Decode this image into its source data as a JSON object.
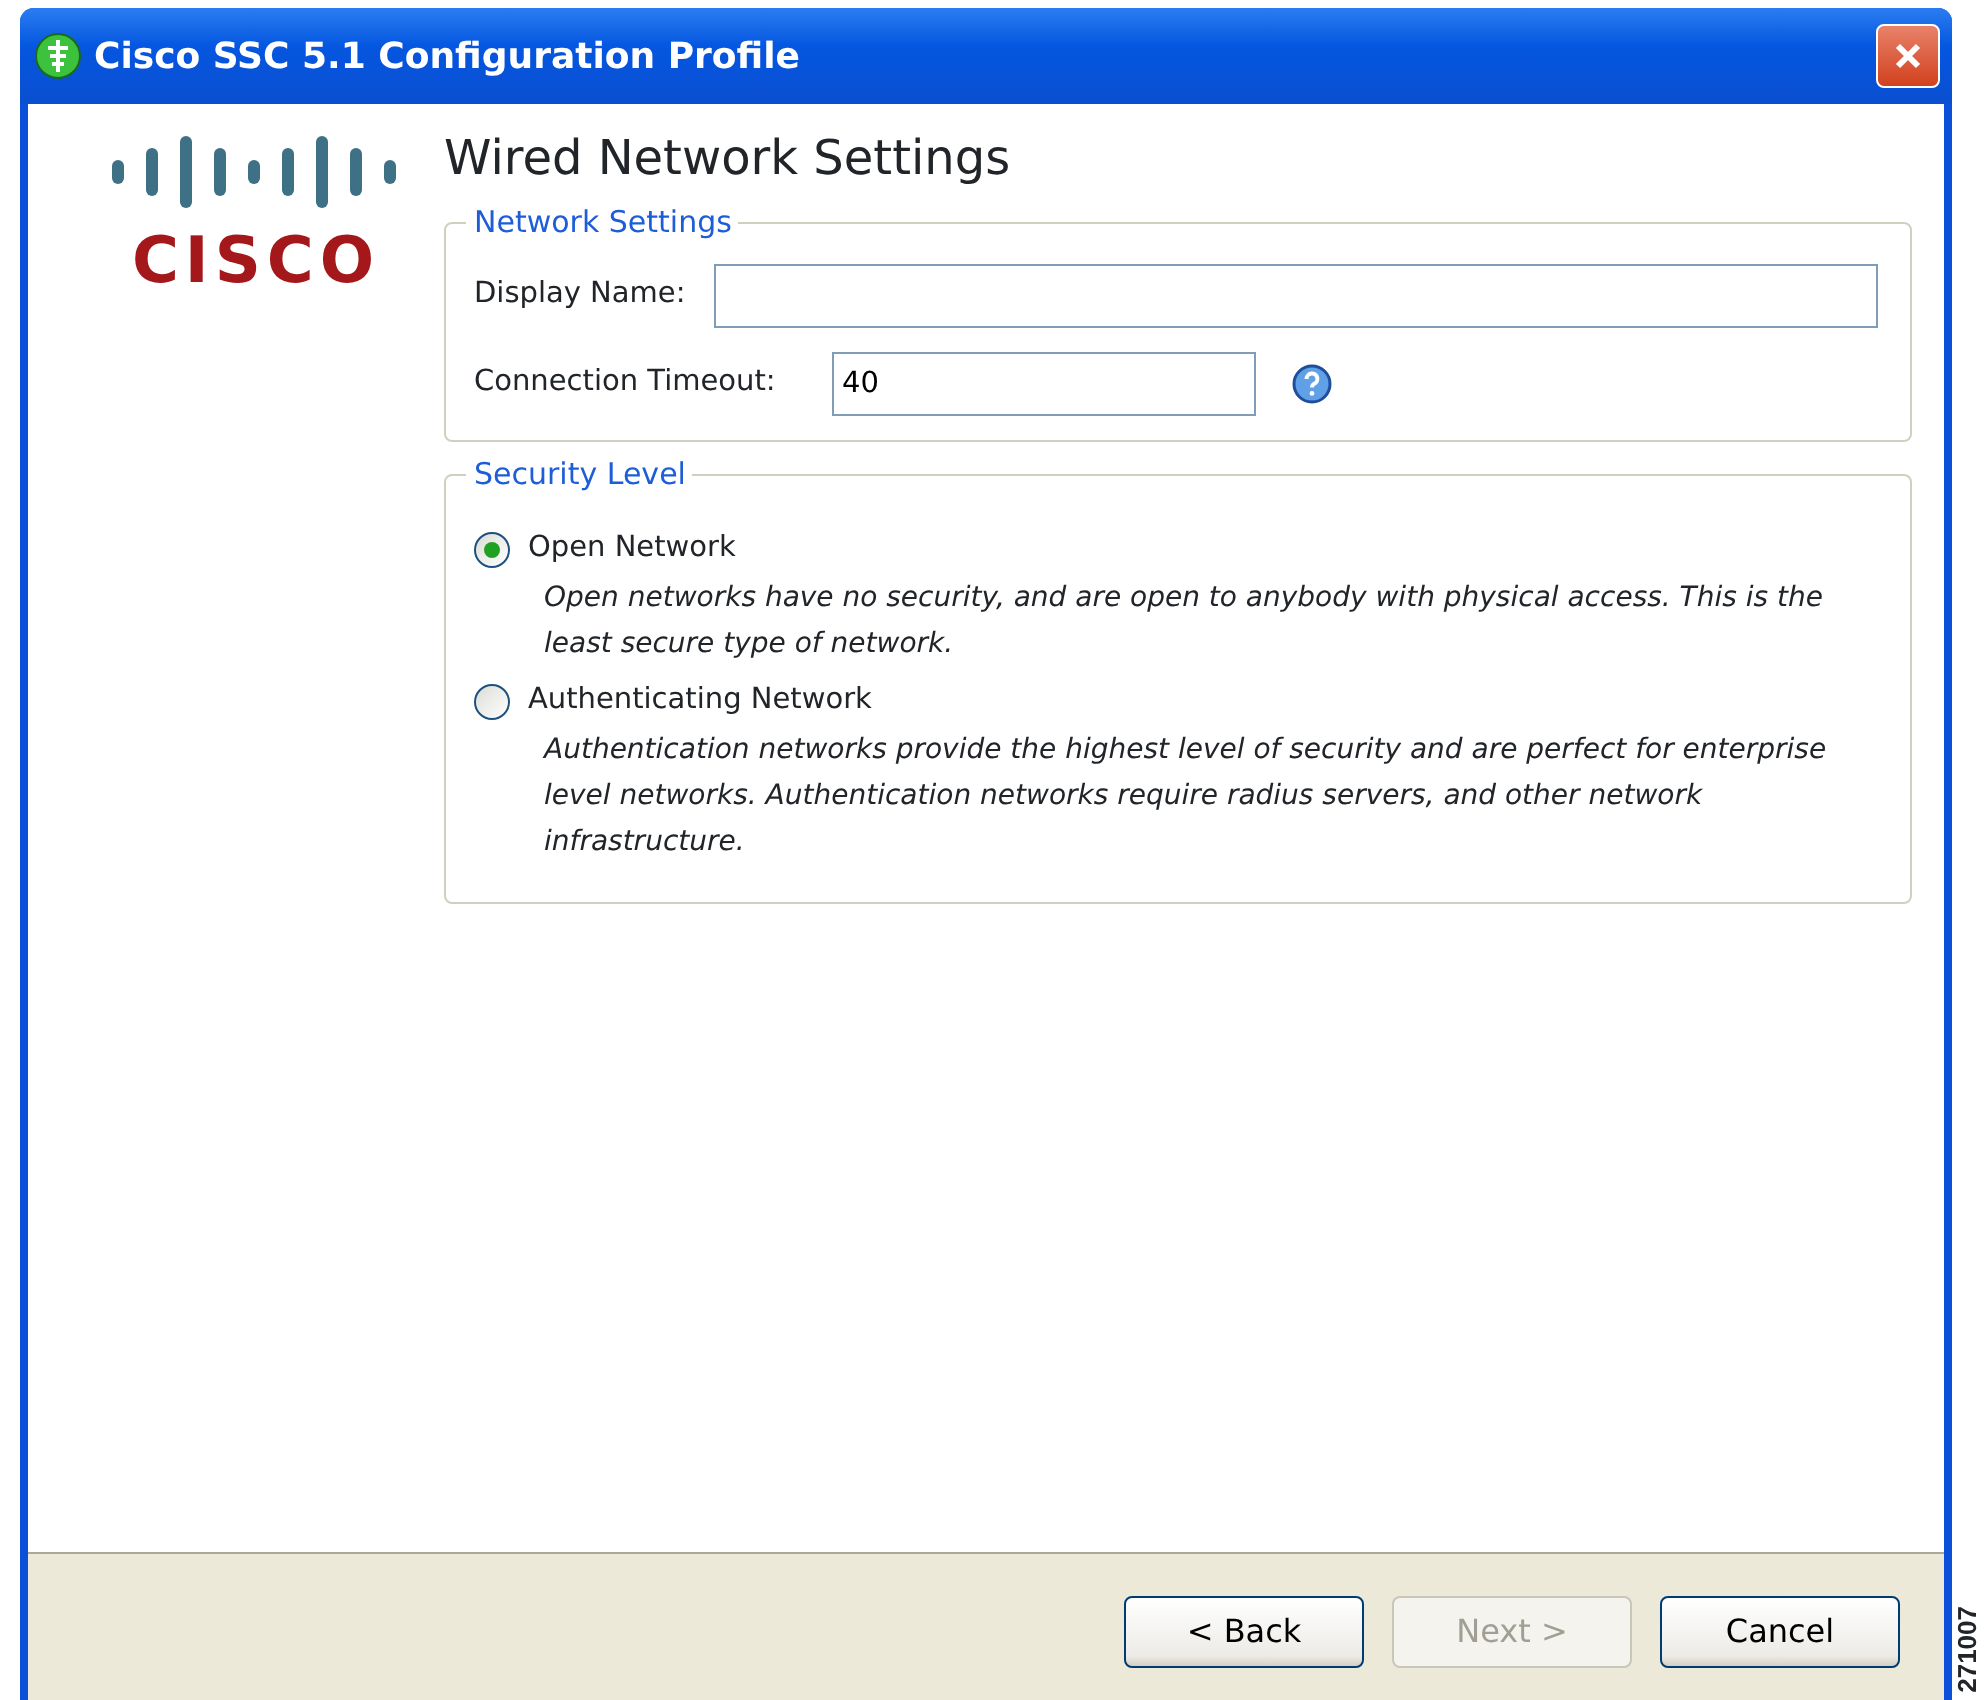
{
  "window": {
    "title": "Cisco SSC 5.1 Configuration Profile"
  },
  "logo": {
    "text": "CISCO"
  },
  "heading": "Wired Network Settings",
  "network_settings": {
    "legend": "Network Settings",
    "fields": [
      {
        "label": "Display Name:",
        "help": false
      },
      {
        "label": "Connection Timeout:",
        "value": "40",
        "help": true
      }
    ]
  },
  "security_level": {
    "legend": "Security Level",
    "options": [
      {
        "label": "Open Network",
        "selected": true,
        "description": "Open networks have no security, and are open to anybody with physical access. This is the least secure type of network."
      },
      {
        "label": "Authenticating Network",
        "selected": false,
        "description": "Authentication networks provide the highest level of security and are perfect for enterprise level networks. Authentication networks require radius servers, and other network infrastructure."
      }
    ]
  },
  "buttons": [
    {
      "label": "< Back",
      "disabled": false
    },
    {
      "label": "Next >",
      "disabled": true
    },
    {
      "label": "Cancel",
      "disabled": false
    }
  ],
  "figure_number": "271007"
}
